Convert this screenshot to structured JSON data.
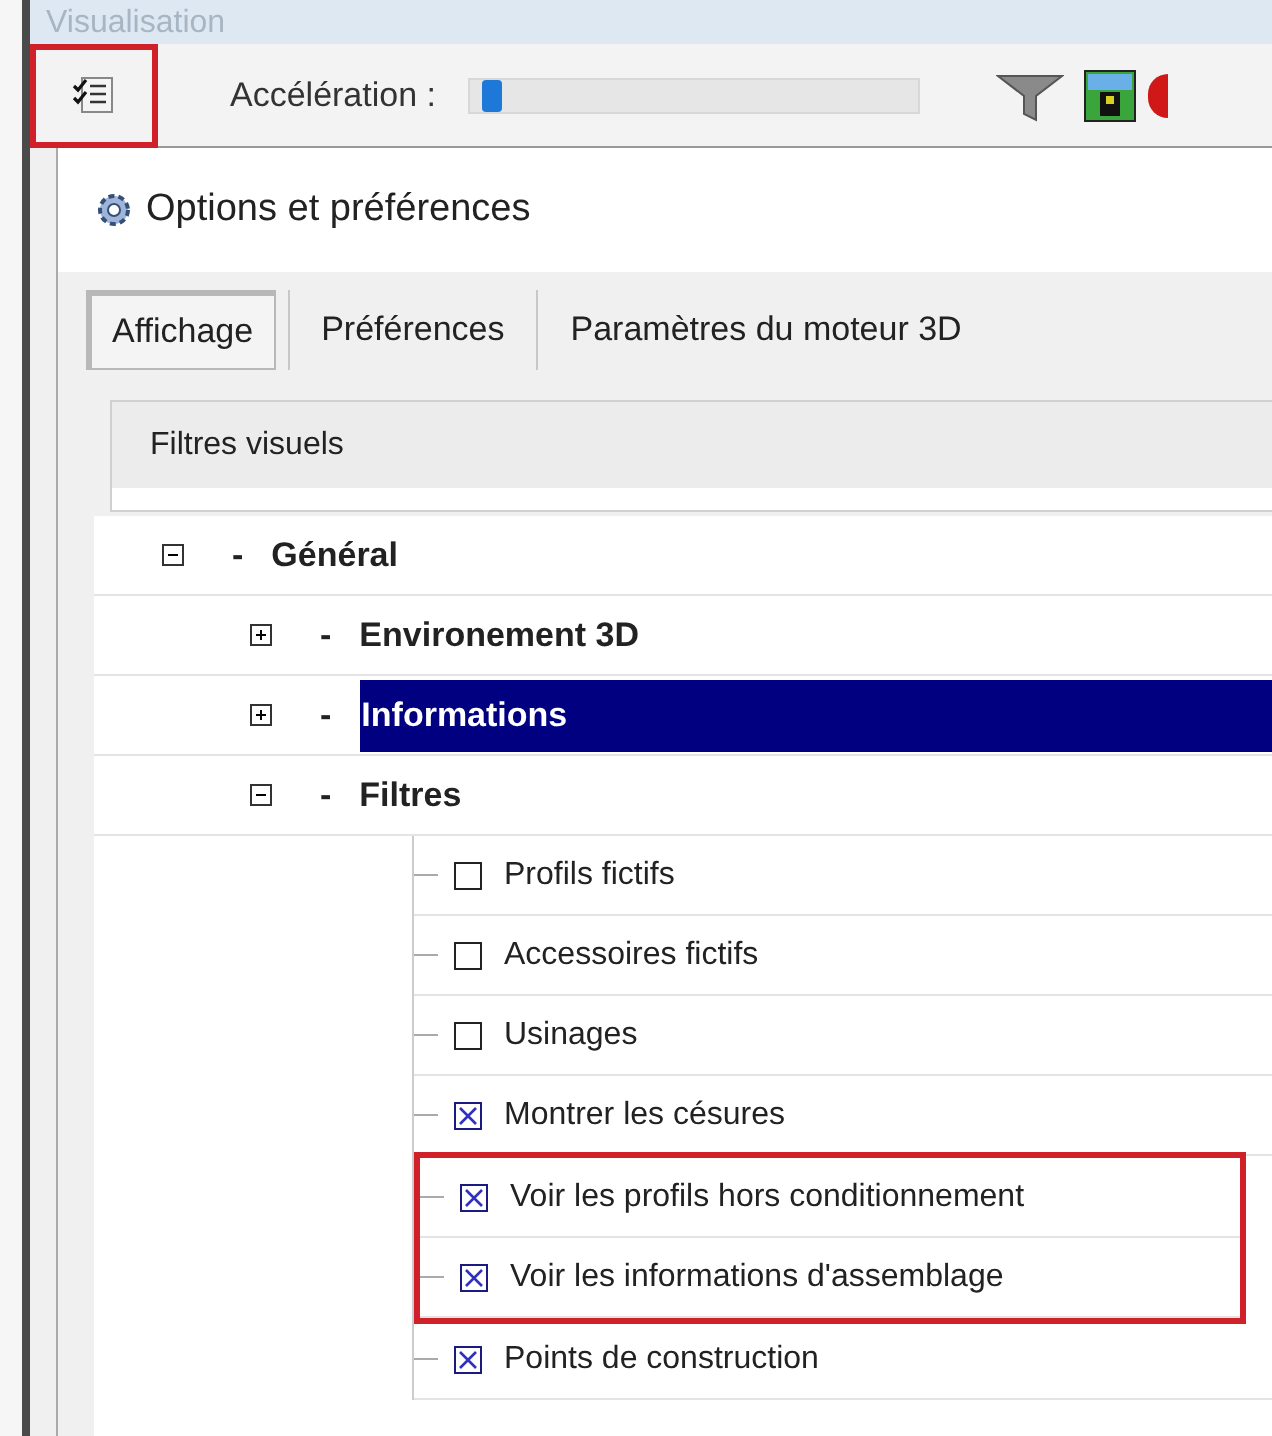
{
  "window": {
    "title": "Visualisation"
  },
  "toolbar": {
    "options_button": {
      "highlighted": true
    },
    "acceleration_label": "Accélération :",
    "acceleration": {
      "level": 0.03
    }
  },
  "dialog": {
    "title": "Options et préférences",
    "tabs": [
      {
        "label": "Affichage",
        "selected": true
      },
      {
        "label": "Préférences",
        "selected": false
      },
      {
        "label": "Paramètres du moteur 3D",
        "selected": false
      }
    ],
    "group_title": "Filtres visuels",
    "tree": [
      {
        "prefix": "-",
        "label": "Général",
        "expanded": true,
        "selected": false,
        "children": [
          {
            "prefix": "-",
            "label": "Environement 3D",
            "expanded": false,
            "selected": false
          },
          {
            "prefix": "-",
            "label": "Informations",
            "expanded": false,
            "selected": true
          },
          {
            "prefix": "-",
            "label": "Filtres",
            "expanded": true,
            "selected": false,
            "options": [
              {
                "label": "Profils fictifs",
                "checked": false,
                "highlighted": false
              },
              {
                "label": "Accessoires fictifs",
                "checked": false,
                "highlighted": false
              },
              {
                "label": "Usinages",
                "checked": false,
                "highlighted": false
              },
              {
                "label": "Montrer les césures",
                "checked": true,
                "highlighted": false
              },
              {
                "label": "Voir les profils hors conditionnement",
                "checked": true,
                "highlighted": true
              },
              {
                "label": "Voir les informations d'assemblage",
                "checked": true,
                "highlighted": true
              },
              {
                "label": "Points de construction",
                "checked": true,
                "highlighted": false
              }
            ]
          }
        ]
      }
    ]
  }
}
